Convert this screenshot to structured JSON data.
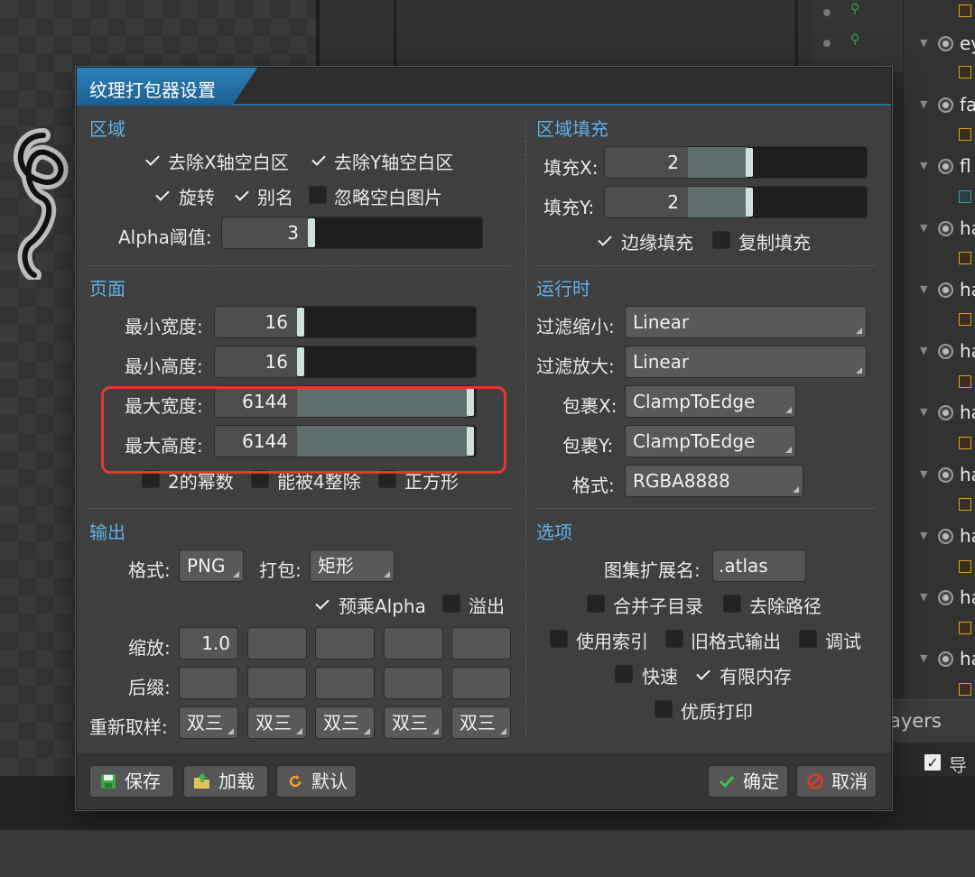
{
  "dialog": {
    "title": "纹理打包器设置",
    "region": {
      "heading": "区域",
      "strip_x": {
        "label": "去除X轴空白区",
        "checked": true
      },
      "strip_y": {
        "label": "去除Y轴空白区",
        "checked": true
      },
      "rotation": {
        "label": "旋转",
        "checked": true
      },
      "alias": {
        "label": "别名",
        "checked": true
      },
      "ignore_blank": {
        "label": "忽略空白图片",
        "checked": false
      },
      "alpha_threshold": {
        "label": "Alpha阈值:",
        "value": "3"
      }
    },
    "padding": {
      "heading": "区域填充",
      "pad_x": {
        "label": "填充X:",
        "value": "2"
      },
      "pad_y": {
        "label": "填充Y:",
        "value": "2"
      },
      "edge_padding": {
        "label": "边缘填充",
        "checked": true
      },
      "duplicate_padding": {
        "label": "复制填充",
        "checked": false
      }
    },
    "page": {
      "heading": "页面",
      "min_width": {
        "label": "最小宽度:",
        "value": "16"
      },
      "min_height": {
        "label": "最小高度:",
        "value": "16"
      },
      "max_width": {
        "label": "最大宽度:",
        "value": "6144"
      },
      "max_height": {
        "label": "最大高度:",
        "value": "6144"
      },
      "power_of_two": {
        "label": "2的幂数",
        "checked": false
      },
      "divisible_by_4": {
        "label": "能被4整除",
        "checked": false
      },
      "square": {
        "label": "正方形",
        "checked": false
      }
    },
    "runtime": {
      "heading": "运行时",
      "filter_min": {
        "label": "过滤缩小:",
        "value": "Linear"
      },
      "filter_mag": {
        "label": "过滤放大:",
        "value": "Linear"
      },
      "wrap_x": {
        "label": "包裹X:",
        "value": "ClampToEdge"
      },
      "wrap_y": {
        "label": "包裹Y:",
        "value": "ClampToEdge"
      },
      "format": {
        "label": "格式:",
        "value": "RGBA8888"
      }
    },
    "output": {
      "heading": "输出",
      "format_label": "格式:",
      "format_value": "PNG",
      "packing_label": "打包:",
      "packing_value": "矩形",
      "premultiply": {
        "label": "预乘Alpha",
        "checked": true
      },
      "bleed": {
        "label": "溢出",
        "checked": false
      },
      "scale_label": "缩放:",
      "scale_values": [
        "1.0",
        "",
        "",
        "",
        ""
      ],
      "suffix_label": "后缀:",
      "suffix_values": [
        "",
        "",
        "",
        "",
        ""
      ],
      "resample_label": "重新取样:",
      "resample_values": [
        "双三",
        "双三",
        "双三",
        "双三",
        "双三"
      ]
    },
    "options": {
      "heading": "选项",
      "atlas_ext": {
        "label": "图集扩展名:",
        "value": ".atlas"
      },
      "combine_subdirs": {
        "label": "合并子目录",
        "checked": false
      },
      "flatten_paths": {
        "label": "去除路径",
        "checked": false
      },
      "use_indexes": {
        "label": "使用索引",
        "checked": false
      },
      "legacy_output": {
        "label": "旧格式输出",
        "checked": false
      },
      "debug": {
        "label": "调试",
        "checked": false
      },
      "fast": {
        "label": "快速",
        "checked": false
      },
      "limit_memory": {
        "label": "有限内存",
        "checked": true
      },
      "pretty_print": {
        "label": "优质打印",
        "checked": false
      }
    },
    "buttons": {
      "save": "保存",
      "load": "加载",
      "default": "默认",
      "ok": "确定",
      "cancel": "取消"
    }
  },
  "background": {
    "tree_labels": [
      "ey",
      "fa",
      "fl",
      "ha",
      "ha",
      "ha",
      "ha",
      "ha",
      "ha",
      "ha",
      "ha"
    ],
    "layers_label": "ayers",
    "export_label": "导出"
  },
  "colors": {
    "accent": "#2d7fb8",
    "section_heading": "#5fb0e8",
    "highlight_box": "#e23a2a",
    "slider_fill": "#5d6e6c"
  }
}
